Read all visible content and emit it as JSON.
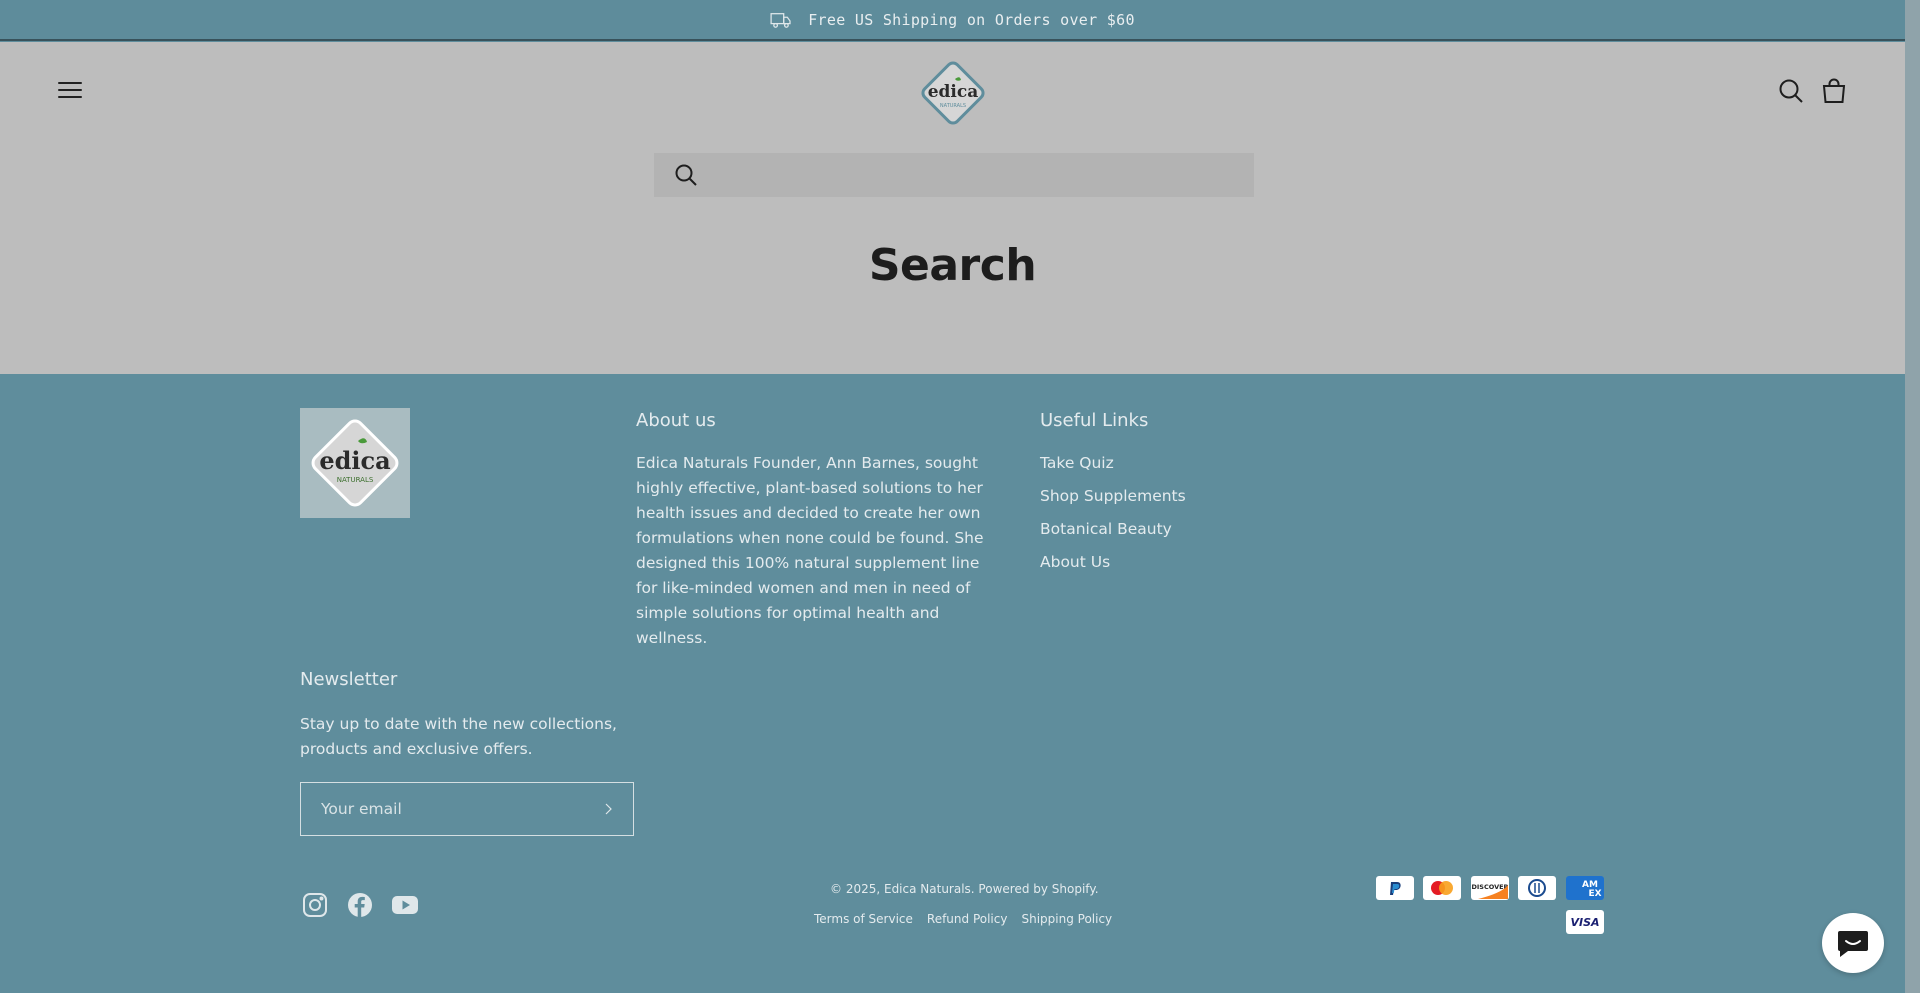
{
  "announcement": {
    "text": "Free US Shipping on Orders over $60",
    "icon": "truck-icon"
  },
  "header": {
    "menu_icon": "hamburger-menu-icon",
    "logo_text": "edica",
    "logo_subtext": "NATURALS",
    "search_icon": "search-icon",
    "cart_icon": "shopping-bag-icon"
  },
  "search": {
    "placeholder": "",
    "value": "",
    "title": "Search"
  },
  "footer": {
    "logo_text": "edica",
    "logo_subtext": "NATURALS",
    "about": {
      "heading": "About us",
      "text": "Edica Naturals Founder, Ann Barnes, sought highly effective, plant-based solutions to her health issues and decided to create her own formulations when none could be found. She designed this 100% natural supplement line for like-minded women and men in need of simple solutions for optimal health and wellness."
    },
    "useful_links": {
      "heading": "Useful Links",
      "items": [
        "Take Quiz",
        "Shop Supplements",
        "Botanical Beauty",
        "About Us"
      ]
    },
    "newsletter": {
      "heading": "Newsletter",
      "text": "Stay up to date with the new collections, products and exclusive offers.",
      "placeholder": "Your email"
    },
    "copyright": "© 2025, Edica Naturals. Powered by Shopify.",
    "policies": [
      "Terms of Service",
      "Refund Policy",
      "Shipping Policy"
    ],
    "social": [
      "instagram-icon",
      "facebook-icon",
      "youtube-icon"
    ],
    "payments": [
      "PayPal",
      "Mastercard",
      "Discover",
      "Diners Club",
      "American Express",
      "Visa"
    ]
  },
  "colors": {
    "brand_teal": "#5f8d9c",
    "main_bg": "#bdbdbd",
    "leaf_green": "#4a9a3a"
  }
}
